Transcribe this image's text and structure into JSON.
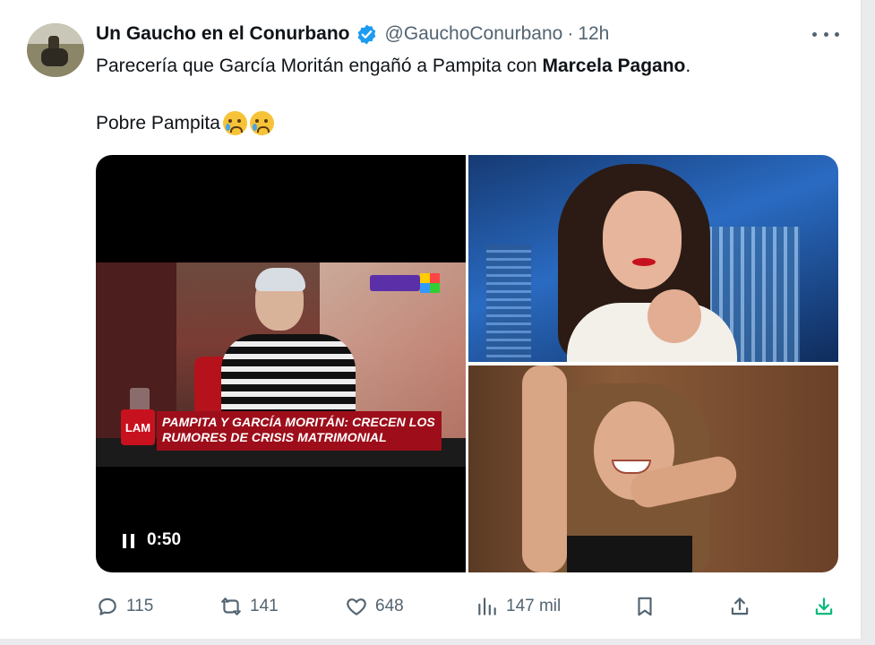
{
  "tweet": {
    "author_name": "Un Gaucho en el Conurbano",
    "handle": "@GauchoConurbano",
    "separator": "·",
    "time": "12h",
    "text_before_bold": "Parecería que García Moritán engañó a Pampita con ",
    "text_bold": "Marcela Pagano",
    "text_after_bold": ".",
    "text_line2": "Pobre Pampita",
    "emojis": [
      "crying-face",
      "crying-face"
    ]
  },
  "media": {
    "video": {
      "duration": "0:50",
      "headline": "PAMPITA Y GARCÍA MORITÁN: CRECEN LOS RUMORES DE CRISIS MATRIMONIAL",
      "channel_logo": "LAM"
    }
  },
  "actions": {
    "replies": "115",
    "retweets": "141",
    "likes": "648",
    "views": "147 mil"
  },
  "colors": {
    "verified": "#1d9bf0",
    "text_secondary": "#536471",
    "download_accent": "#00ba7c",
    "lower_third": "#9d0e1a"
  }
}
